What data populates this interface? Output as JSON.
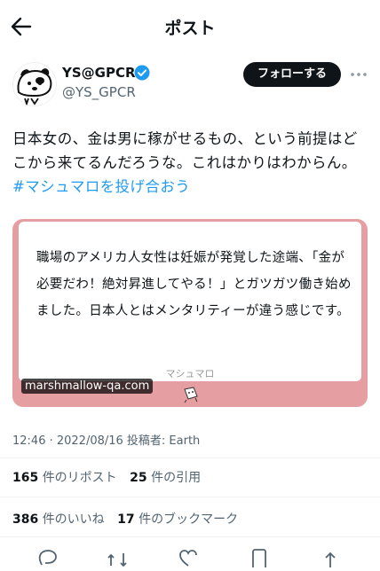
{
  "header": {
    "title": "ポスト"
  },
  "author": {
    "name": "YS@GPCR",
    "handle": "@YS_GPCR",
    "follow_label": "フォローする"
  },
  "tweet": {
    "text": "日本女の、金は男に稼がせるもの、という前提はどこから来てるんだろうな。これはかりはわからん。",
    "hashtag": "#マシュマロを投げ合おう"
  },
  "card": {
    "text": "職場のアメリカ人女性は妊娠が発覚した途端、「金が必要だわ！絶対昇進してやる！」とガツガツ働き始めました。日本人とはメンタリティーが違う感じです。",
    "label": "マシュマロ",
    "domain": "marshmallow-qa.com"
  },
  "meta": {
    "text": "12:46 · 2022/08/16 投稿者: Earth"
  },
  "stats": {
    "reposts_count": "165",
    "reposts_label": "件のリポスト",
    "quotes_count": "25",
    "quotes_label": "件の引用",
    "likes_count": "386",
    "likes_label": "件のいいね",
    "bookmarks_count": "17",
    "bookmarks_label": "件のブックマーク"
  },
  "colors": {
    "accent": "#1d9bf0",
    "card_background": "#e59ea1",
    "follow_button": "#0f1419"
  },
  "icons": [
    "back-arrow-icon",
    "verified-badge-icon",
    "more-icon",
    "reply-icon",
    "repost-icon",
    "like-icon",
    "bookmark-icon",
    "share-icon"
  ]
}
